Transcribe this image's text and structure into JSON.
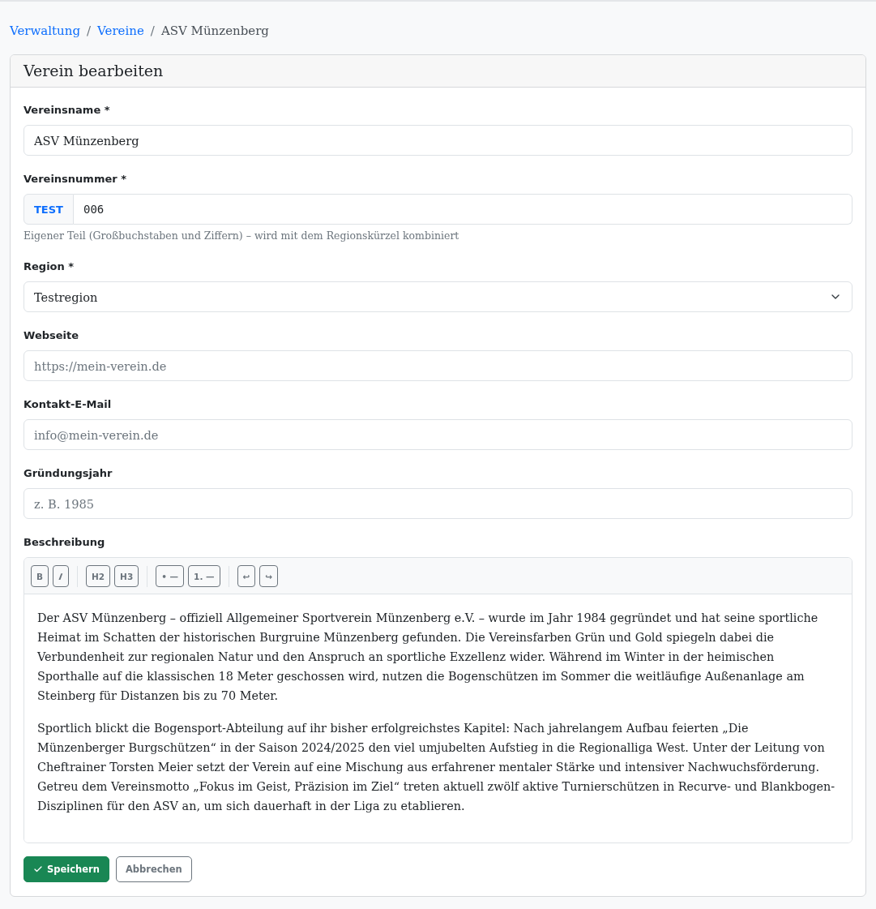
{
  "breadcrumb": [
    {
      "kind": "link",
      "label": "Verwaltung"
    },
    {
      "kind": "separator",
      "label": "/"
    },
    {
      "kind": "link",
      "label": "Vereine"
    },
    {
      "kind": "separator",
      "label": "/"
    },
    {
      "kind": "current",
      "label": "ASV Münzenberg"
    }
  ],
  "card": {
    "title": "Verein bearbeiten"
  },
  "fields": [
    {
      "kind": "text",
      "label": "Vereinsname *",
      "value": "ASV Münzenberg"
    },
    {
      "kind": "prefixed",
      "label": "Vereinsnummer *",
      "prefix": "TEST",
      "value": "006",
      "help": "Eigener Teil (Großbuchstaben und Ziffern) – wird mit dem Regionskürzel kombiniert"
    },
    {
      "kind": "select",
      "label": "Region *",
      "value": "Testregion"
    },
    {
      "kind": "text",
      "label": "Webseite",
      "placeholder": "https://mein-verein.de"
    },
    {
      "kind": "text",
      "label": "Kontakt-E-Mail",
      "placeholder": "info@mein-verein.de"
    },
    {
      "kind": "text",
      "label": "Gründungsjahr",
      "placeholder": "z. B. 1985"
    },
    {
      "kind": "editor",
      "label": "Beschreibung",
      "toolbar": [
        [
          {
            "label": "B",
            "italic": false
          },
          {
            "label": "I",
            "italic": true
          }
        ],
        [
          {
            "label": "H2",
            "italic": false
          },
          {
            "label": "H3",
            "italic": false
          }
        ],
        [
          {
            "label": "• —",
            "italic": false
          },
          {
            "label": "1. —",
            "italic": false
          }
        ],
        [
          {
            "label": "↩",
            "italic": false
          },
          {
            "label": "↪",
            "italic": false
          }
        ]
      ],
      "paragraphs": [
        "Der ASV Münzenberg – offiziell Allgemeiner Sportverein Münzenberg e.V. – wurde im Jahr 1984 gegründet und hat seine sportliche Heimat im Schatten der historischen Burgruine Münzenberg gefunden. Die Vereinsfarben Grün und Gold spiegeln dabei die Verbundenheit zur regionalen Natur und den Anspruch an sportliche Exzellenz wider. Während im Winter in der heimischen Sporthalle auf die klassischen 18 Meter geschossen wird, nutzen die Bogenschützen im Sommer die weitläufige Außenanlage am Steinberg für Distanzen bis zu 70 Meter.",
        "Sportlich blickt die Bogensport-Abteilung auf ihr bisher erfolgreichstes Kapitel: Nach jahrelangem Aufbau feierten „Die Münzenberger Burgschützen“ in der Saison 2024/2025 den viel umjubelten Aufstieg in die Regionalliga West. Unter der Leitung von Cheftrainer Torsten Meier setzt der Verein auf eine Mischung aus erfahrener mentaler Stärke und intensiver Nachwuchsförderung. Getreu dem Vereinsmotto „Fokus im Geist, Präzision im Ziel“ treten aktuell zwölf aktive Turnierschützen in Recurve- und Blankbogen-Disziplinen für den ASV an, um sich dauerhaft in der Liga zu etablieren."
      ]
    }
  ],
  "buttons": [
    {
      "kind": "primary",
      "label": "Speichern"
    },
    {
      "kind": "secondary",
      "label": "Abbrechen"
    }
  ]
}
